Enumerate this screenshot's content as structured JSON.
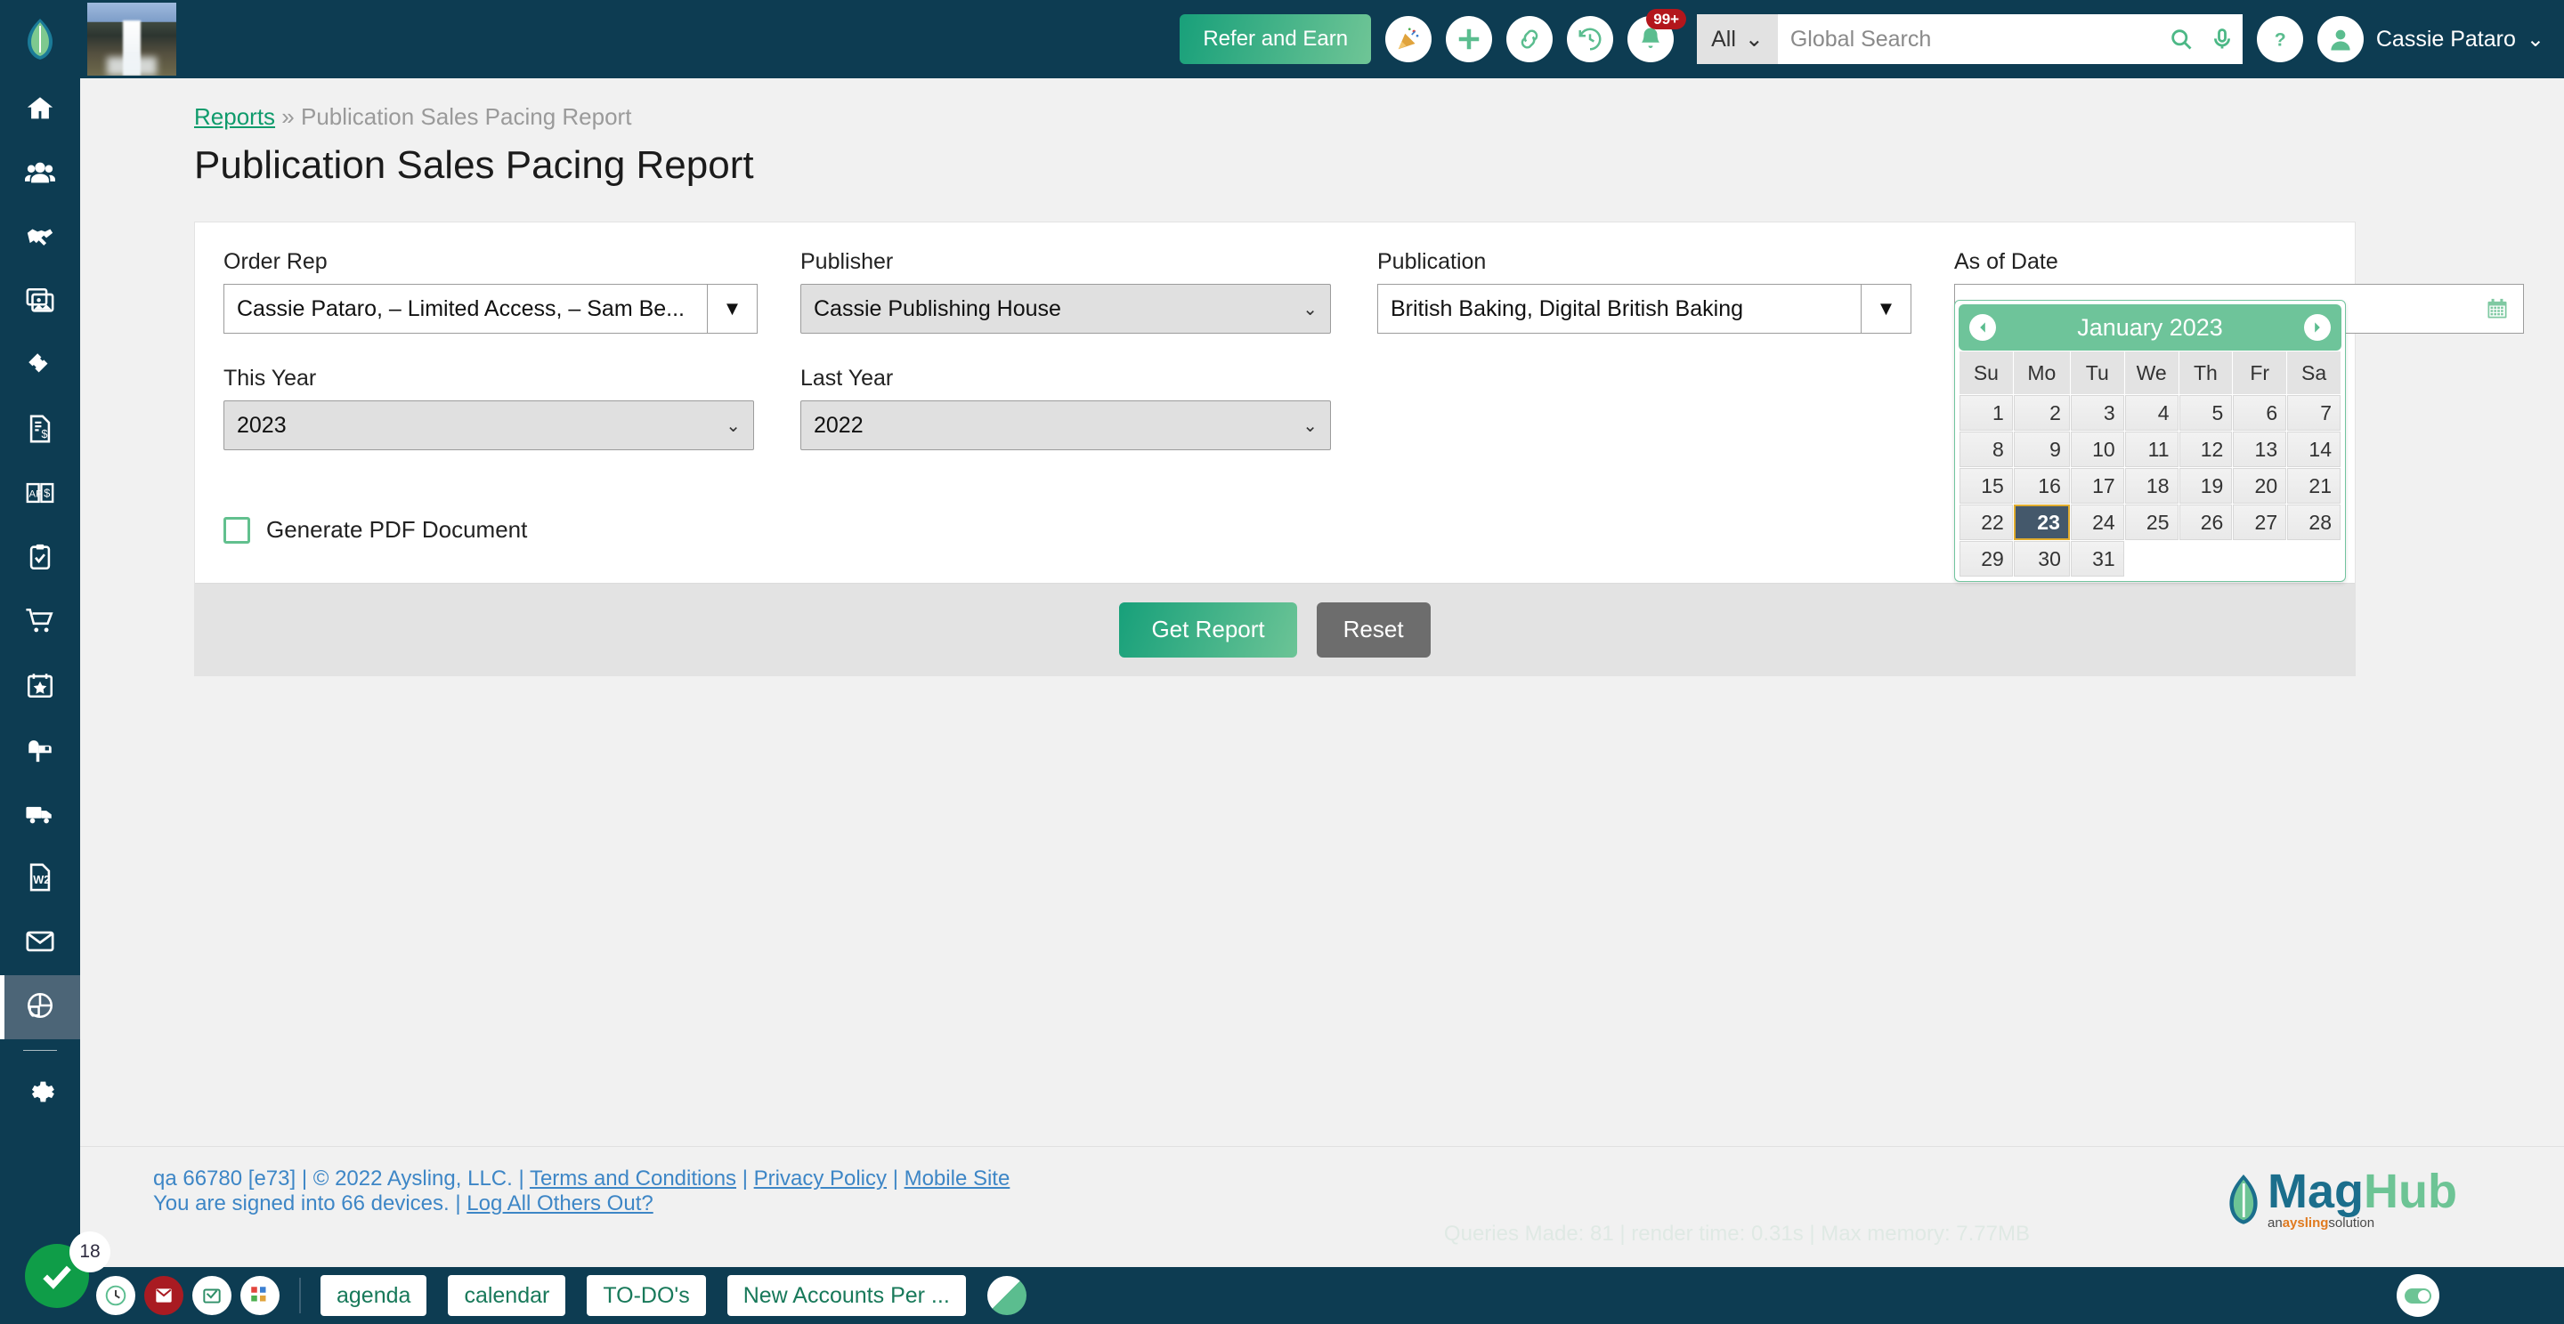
{
  "sidebar": {
    "logo_icon": "maghub-leaf-logo-icon",
    "items": [
      {
        "icon": "home-icon",
        "name": "sidebar-item-home",
        "active": false
      },
      {
        "icon": "people-icon",
        "name": "sidebar-item-contacts",
        "active": false
      },
      {
        "icon": "handshake-icon",
        "name": "sidebar-item-deals",
        "active": false
      },
      {
        "icon": "images-icon",
        "name": "sidebar-item-media",
        "active": false
      },
      {
        "icon": "tickets-icon",
        "name": "sidebar-item-tickets",
        "active": false
      },
      {
        "icon": "invoice-dollar-icon",
        "name": "sidebar-item-invoices",
        "active": false
      },
      {
        "icon": "ap-ar-book-icon",
        "name": "sidebar-item-accounting",
        "active": false
      },
      {
        "icon": "clipboard-check-icon",
        "name": "sidebar-item-tasks",
        "active": false
      },
      {
        "icon": "shopping-cart-icon",
        "name": "sidebar-item-orders",
        "active": false
      },
      {
        "icon": "calendar-star-icon",
        "name": "sidebar-item-events",
        "active": false
      },
      {
        "icon": "mailbox-icon",
        "name": "sidebar-item-mailbox",
        "active": false
      },
      {
        "icon": "truck-icon",
        "name": "sidebar-item-distribution",
        "active": false
      },
      {
        "icon": "w2-document-icon",
        "name": "sidebar-item-w2",
        "active": false
      },
      {
        "icon": "envelope-icon",
        "name": "sidebar-item-email",
        "active": false
      },
      {
        "icon": "pie-chart-icon",
        "name": "sidebar-item-reports",
        "active": true
      },
      {
        "icon": "gear-icon",
        "name": "sidebar-item-settings",
        "active": false
      }
    ]
  },
  "header": {
    "refer_label": "Refer and Earn",
    "icons": [
      {
        "name": "party-popper-icon",
        "badge": null
      },
      {
        "name": "plus-icon",
        "badge": null
      },
      {
        "name": "link-icon",
        "badge": null
      },
      {
        "name": "history-clock-icon",
        "badge": null
      },
      {
        "name": "bell-icon",
        "badge": "99+"
      }
    ],
    "search_scope": "All",
    "search_placeholder": "Global Search",
    "search_value": "",
    "help_icon": "question-mark-icon",
    "avatar_icon": "user-avatar-icon",
    "user_name": "Cassie Pataro",
    "user_caret": "⌄"
  },
  "breadcrumb": {
    "root": "Reports",
    "separator": "»",
    "current": "Publication Sales Pacing Report"
  },
  "page_title": "Publication Sales Pacing Report",
  "form": {
    "order_rep": {
      "label": "Order Rep",
      "value": "Cassie Pataro, – Limited Access, – Sam Be...",
      "arrow": "▼"
    },
    "publisher": {
      "label": "Publisher",
      "value": "Cassie Publishing House",
      "chevron": "⌄"
    },
    "publication": {
      "label": "Publication",
      "value": "British Baking, Digital British Baking",
      "arrow": "▼"
    },
    "as_of_date": {
      "label": "As of Date",
      "value": "01/23/2023",
      "icon": "calendar-icon"
    },
    "this_year": {
      "label": "This Year",
      "value": "2023",
      "chevron": "⌄"
    },
    "last_year": {
      "label": "Last Year",
      "value": "2022",
      "chevron": "⌄"
    },
    "generate_pdf": {
      "label": "Generate PDF Document",
      "checked": false
    },
    "get_report_label": "Get Report",
    "reset_label": "Reset"
  },
  "datepicker": {
    "title": "January 2023",
    "prev_icon": "chevron-left-icon",
    "next_icon": "chevron-right-icon",
    "weekdays": [
      "Su",
      "Mo",
      "Tu",
      "We",
      "Th",
      "Fr",
      "Sa"
    ],
    "weeks": [
      [
        "1",
        "2",
        "3",
        "4",
        "5",
        "6",
        "7"
      ],
      [
        "8",
        "9",
        "10",
        "11",
        "12",
        "13",
        "14"
      ],
      [
        "15",
        "16",
        "17",
        "18",
        "19",
        "20",
        "21"
      ],
      [
        "22",
        "23",
        "24",
        "25",
        "26",
        "27",
        "28"
      ],
      [
        "29",
        "30",
        "31",
        "",
        "",
        "",
        ""
      ]
    ],
    "selected": "23"
  },
  "footer": {
    "build": "qa 66780 [e73]",
    "copyright": "© 2022 Aysling, LLC.",
    "terms": "Terms and Conditions",
    "privacy": "Privacy Policy",
    "mobile": "Mobile Site",
    "devices_text": "You are signed into 66 devices.",
    "logout_others": "Log All Others Out?",
    "perf": "Queries Made: 81 | render time: 0.31s | Max memory: 7.77MB",
    "logo_mag": "Mag",
    "logo_hub": "Hub",
    "logo_tag_an": "an",
    "logo_tag_aysling": "aysling",
    "logo_tag_solution": "solution"
  },
  "taskbar": {
    "fab_icon": "check-icon",
    "fab_badge": "18",
    "icons": [
      {
        "name": "clock-icon"
      },
      {
        "name": "mail-alert-icon"
      },
      {
        "name": "mail-open-icon"
      },
      {
        "name": "confetti-icon"
      }
    ],
    "buttons": [
      "agenda",
      "calendar",
      "TO-DO's",
      "New Accounts Per ..."
    ],
    "pencil_icon": "pencil-icon",
    "toggle_icon": "toggle-switch-icon"
  },
  "colors": {
    "brand_dark": "#0d3c52",
    "accent_green": "#6dc495",
    "link_blue": "#3d86c6",
    "selected_day": "#44586b",
    "selected_day_border": "#e0ac2e"
  }
}
